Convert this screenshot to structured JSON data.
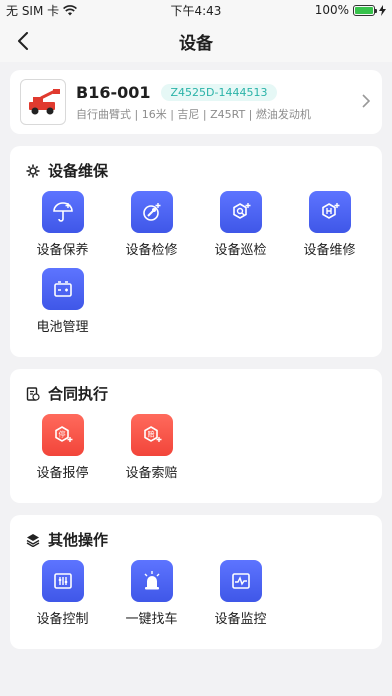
{
  "status_bar": {
    "carrier": "无 SIM 卡",
    "time": "下午4:43",
    "battery": "100%"
  },
  "navbar": {
    "title": "设备"
  },
  "device": {
    "code": "B16-001",
    "serial": "Z4525D-1444513",
    "specs": "自行曲臂式 | 16米 | 吉尼 | Z45RT | 燃油发动机"
  },
  "sections": {
    "maintenance": {
      "title": "设备维保",
      "items": [
        "设备保养",
        "设备检修",
        "设备巡检",
        "设备维修",
        "电池管理"
      ]
    },
    "contract": {
      "title": "合同执行",
      "items": [
        "设备报停",
        "设备索赔"
      ]
    },
    "other": {
      "title": "其他操作",
      "items": [
        "设备控制",
        "一键找车",
        "设备监控"
      ]
    }
  },
  "colors": {
    "tile_blue": "#4a63f2",
    "tile_red": "#f5503f",
    "serial_teal": "#2bb3a8",
    "truck_red": "#e03a2f"
  }
}
